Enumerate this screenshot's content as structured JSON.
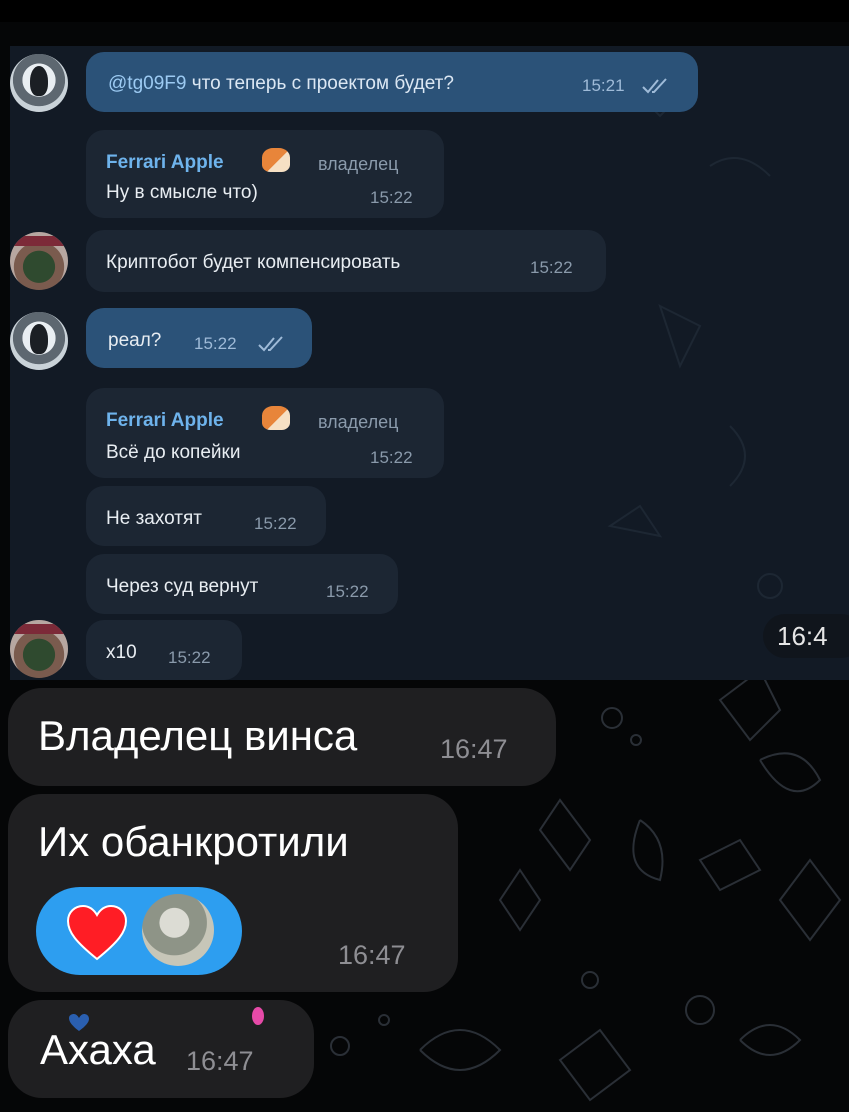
{
  "embedded_chat": {
    "messages": [
      {
        "mention": "@tg09F9",
        "text": "что теперь с проектом будет?",
        "time": "15:21"
      },
      {
        "sender": "Ferrari Apple",
        "role": "владелец",
        "text": "Ну в смысле что)",
        "time": "15:22"
      },
      {
        "text": "Криптобот будет компенсировать",
        "time": "15:22"
      },
      {
        "text": "реал?",
        "time": "15:22"
      },
      {
        "sender": "Ferrari Apple",
        "role": "владелец",
        "text": "Всё до копейки",
        "time": "15:22"
      },
      {
        "text": "Не захотят",
        "time": "15:22"
      },
      {
        "text": "Через суд вернут",
        "time": "15:22"
      },
      {
        "text": "x10",
        "time": "15:22"
      }
    ],
    "cut_time": "16:4"
  },
  "outer_chat": {
    "messages": [
      {
        "text": "Владелец винса",
        "time": "16:47"
      },
      {
        "text": "Их обанкротили",
        "time": "16:47"
      },
      {
        "text": "Ахаха",
        "time": "16:47"
      }
    ]
  },
  "colors": {
    "outgoing_bubble": "#2b5278",
    "incoming_bubble": "#1c2633",
    "sender_name": "#6eb3ec",
    "reaction": "#2d9ef0",
    "outer_bubble": "#1f1f21"
  },
  "icons": [
    "double-check-icon",
    "fox-emoji-icon",
    "heart-reaction-icon",
    "user-avatar"
  ]
}
